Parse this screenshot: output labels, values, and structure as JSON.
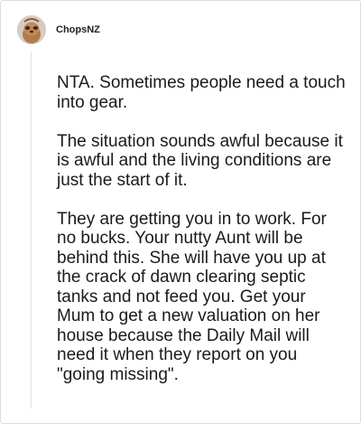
{
  "comment": {
    "author": "ChopsNZ",
    "avatar_icon": "sloth-avatar-icon",
    "paragraphs": [
      "NTA. Sometimes people need a touch into gear.",
      "The situation sounds awful because it is awful and the living conditions are just the start of it.",
      "They are getting you in to work. For no bucks. Your nutty Aunt will be behind this. She will have you up at the crack of dawn clearing septic tanks and not feed you. Get your Mum to get a new valuation on her house because the Daily Mail will need it when they report on you \"going missing\"."
    ]
  },
  "colors": {
    "background": "#ffffff",
    "border": "#dcdcdc",
    "text": "#1a1a1a",
    "thread_line": "#e2e2e2"
  }
}
